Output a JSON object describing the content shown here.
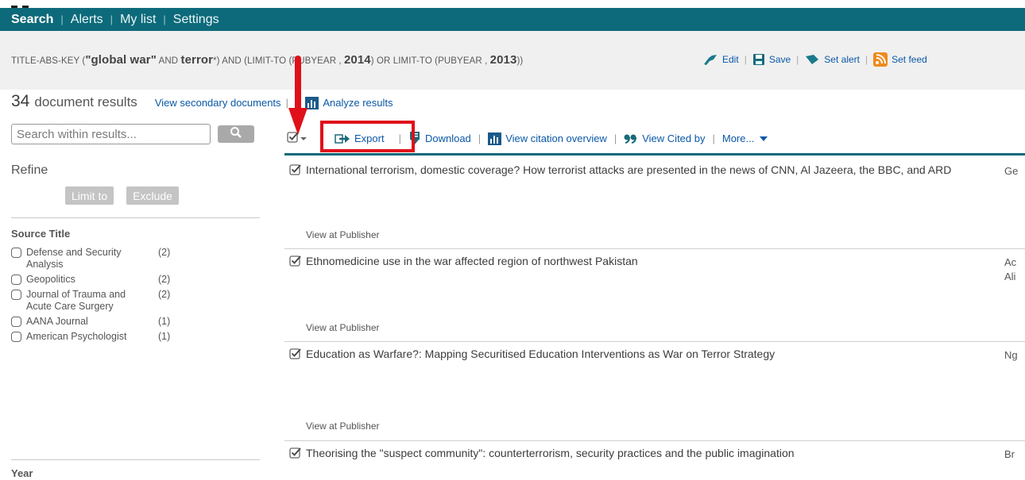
{
  "nav": {
    "items": [
      "Search",
      "Alerts",
      "My list",
      "Settings"
    ],
    "active": "Search"
  },
  "query": {
    "prefix": "TITLE-ABS-KEY (",
    "term1": "\"global war\"",
    "op1": " AND ",
    "term2": "terror",
    "mid": "*) AND (LIMIT-TO (PUBYEAR , ",
    "year1": "2014",
    "mid2": ") OR LIMIT-TO (PUBYEAR , ",
    "year2": "2013",
    "suffix": "))",
    "actions": {
      "edit": "Edit",
      "save": "Save",
      "set_alert": "Set alert",
      "set_feed": "Set feed"
    }
  },
  "results_heading": {
    "count": "34",
    "label": "document results",
    "secondary_link": "View secondary documents",
    "analyze_link": "Analyze results"
  },
  "sidebar": {
    "search_placeholder": "Search within results...",
    "refine_label": "Refine",
    "limit_to": "Limit to",
    "exclude": "Exclude",
    "source_title": "Source Title",
    "sources": [
      {
        "name": "Defense and Security Analysis",
        "count": "(2)"
      },
      {
        "name": "Geopolitics",
        "count": "(2)"
      },
      {
        "name": "Journal of Trauma and Acute Care Surgery",
        "count": "(2)"
      },
      {
        "name": "AANA Journal",
        "count": "(1)"
      },
      {
        "name": "American Psychologist",
        "count": "(1)"
      }
    ],
    "year_title": "Year"
  },
  "toolbar": {
    "export": "Export",
    "download": "Download",
    "citation_overview": "View citation overview",
    "cited_by": "View Cited by",
    "more": "More..."
  },
  "results": [
    {
      "title": "International terrorism, domestic coverage? How terrorist attacks are presented in the news of CNN, Al Jazeera, the BBC, and ARD",
      "author": "Ge",
      "publisher": "View at Publisher"
    },
    {
      "title": "Ethnomedicine use in the war affected region of northwest Pakistan",
      "author": "Ac\nAli",
      "publisher": "View at Publisher"
    },
    {
      "title": "Education as Warfare?: Mapping Securitised Education Interventions as War on Terror Strategy",
      "author": "Ng",
      "publisher": "View at Publisher"
    },
    {
      "title": "Theorising the \"suspect community\": counterterrorism, security practices and the public imagination",
      "author": "Br",
      "publisher": ""
    }
  ],
  "colors": {
    "nav_bg": "#0d6a7a",
    "link": "#0a58a6",
    "highlight": "#e0101a"
  }
}
